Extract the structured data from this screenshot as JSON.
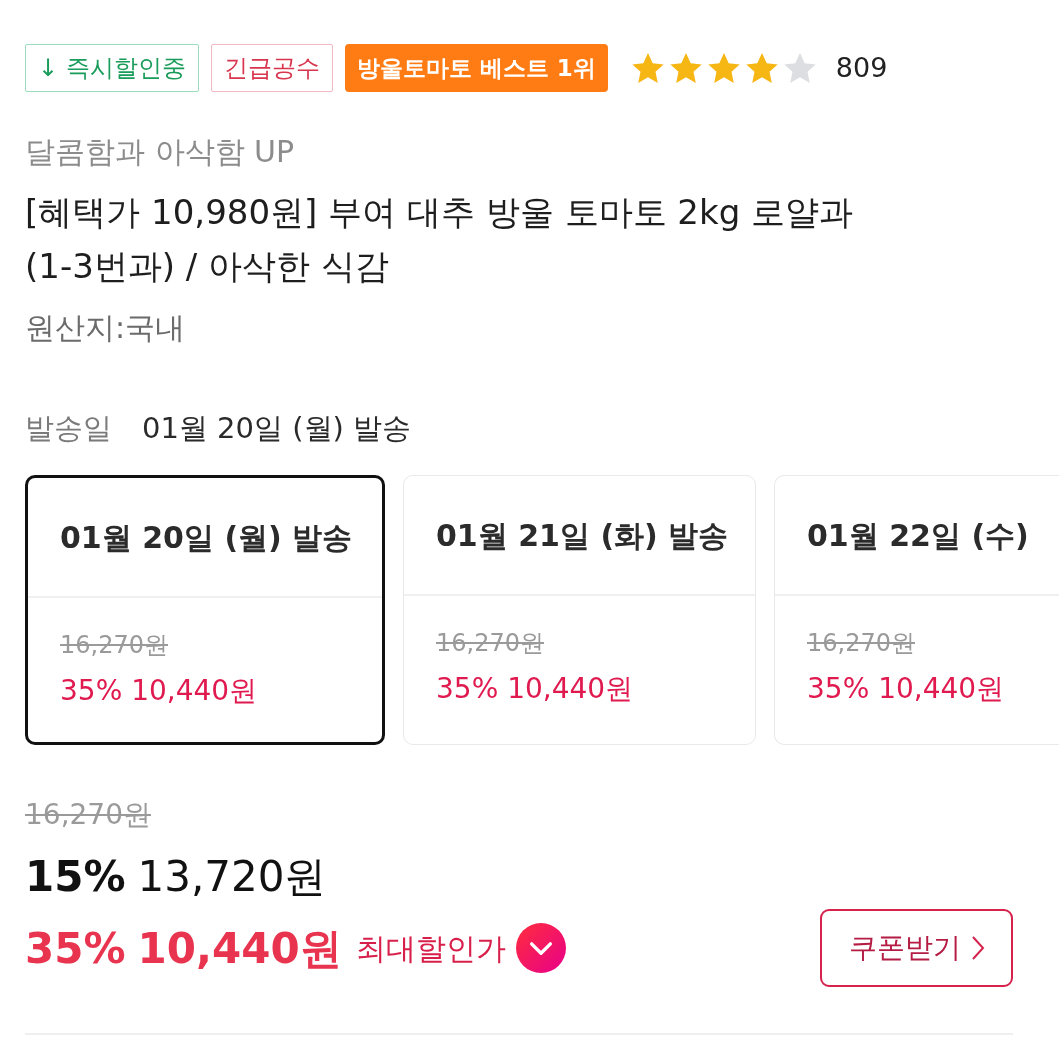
{
  "badges": [
    {
      "kind": "instant",
      "label": "↓ 즉시할인중"
    },
    {
      "kind": "urgent",
      "label": "긴급공수"
    },
    {
      "kind": "best",
      "label": "방울토마토 베스트 1위"
    }
  ],
  "rating": {
    "stars": 4,
    "count": "809"
  },
  "subtitle": "달콤함과 아삭함 UP",
  "title": "[혜택가 10,980원] 부여 대추 방울 토마토 2kg 로얄과 (1-3번과) / 아삭한 식감",
  "origin": "원산지:국내",
  "shipping": {
    "label": "발송일",
    "value": "01월 20일 (월) 발송"
  },
  "ship_options": [
    {
      "date": "01월 20일 (월) 발송",
      "original_price": "16,270원",
      "sale_price": "35% 10,440원",
      "selected": true
    },
    {
      "date": "01월 21일 (화) 발송",
      "original_price": "16,270원",
      "sale_price": "35% 10,440원",
      "selected": false
    },
    {
      "date": "01월 22일 (수)",
      "original_price": "16,270원",
      "sale_price": "35% 10,440원",
      "selected": false
    }
  ],
  "price": {
    "original": "16,270원",
    "discount_rate": "15%",
    "discounted": "13,720원",
    "best_rate": "35%",
    "best": "10,440원",
    "best_label": "최대할인가"
  },
  "coupon_button": {
    "label": "쿠폰받기"
  }
}
